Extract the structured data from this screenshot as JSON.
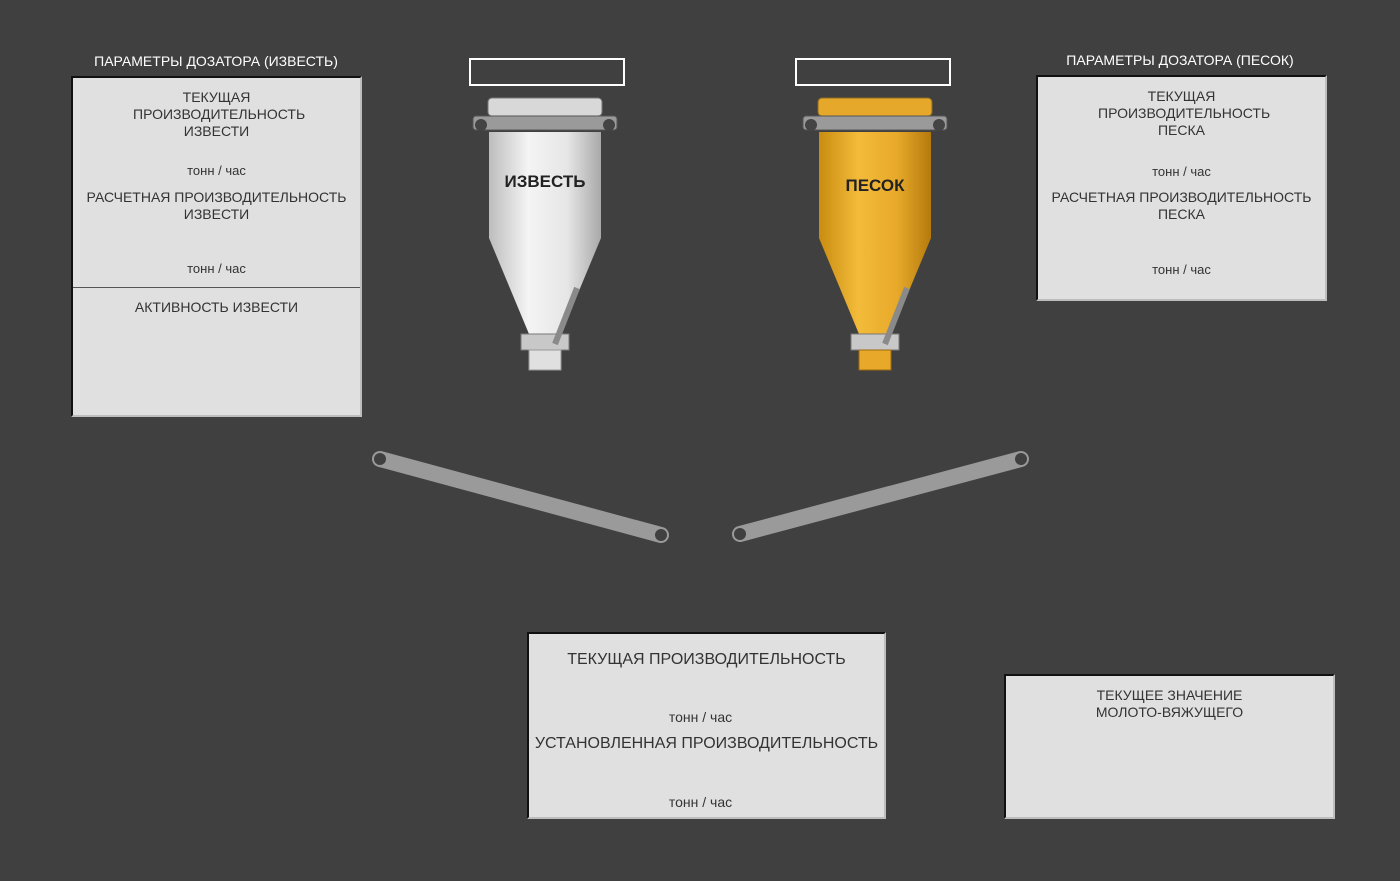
{
  "lime_dosing": {
    "section_title": "ПАРАМЕТРЫ ДОЗАТОРА (ИЗВЕСТЬ)",
    "current_label": "ТЕКУЩАЯ ПРОИЗВОДИТЕЛЬНОСТЬ ИЗВЕСТИ",
    "current_unit": "тонн / час",
    "calc_label": "РАСЧЕТНАЯ ПРОИЗВОДИТЕЛЬНОСТЬ ИЗВЕСТИ",
    "calc_unit": "тонн / час",
    "activity_label": "АКТИВНОСТЬ ИЗВЕСТИ"
  },
  "sand_dosing": {
    "section_title": "ПАРАМЕТРЫ ДОЗАТОРА (ПЕСОК)",
    "current_label": "ТЕКУЩАЯ ПРОИЗВОДИТЕЛЬНОСТЬ ПЕСКА",
    "current_unit": "тонн / час",
    "calc_label": "РАСЧЕТНАЯ ПРОИЗВОДИТЕЛЬНОСТЬ ПЕСКА",
    "calc_unit": "тонн / час"
  },
  "hoppers": {
    "lime_label": "ИЗВЕСТЬ",
    "sand_label": "ПЕСОК",
    "lime_color": "#e8e8e8",
    "sand_color": "#e8a92a"
  },
  "mixer": {
    "current_label": "ТЕКУЩАЯ ПРОИЗВОДИТЕЛЬНОСТЬ",
    "current_unit": "тонн / час",
    "set_label": "УСТАНОВЛЕННАЯ ПРОИЗВОДИТЕЛЬНОСТЬ",
    "set_unit": "тонн / час"
  },
  "binder": {
    "label": "ТЕКУЩЕЕ ЗНАЧЕНИЕ МОЛОТО-ВЯЖУЩЕГО"
  }
}
